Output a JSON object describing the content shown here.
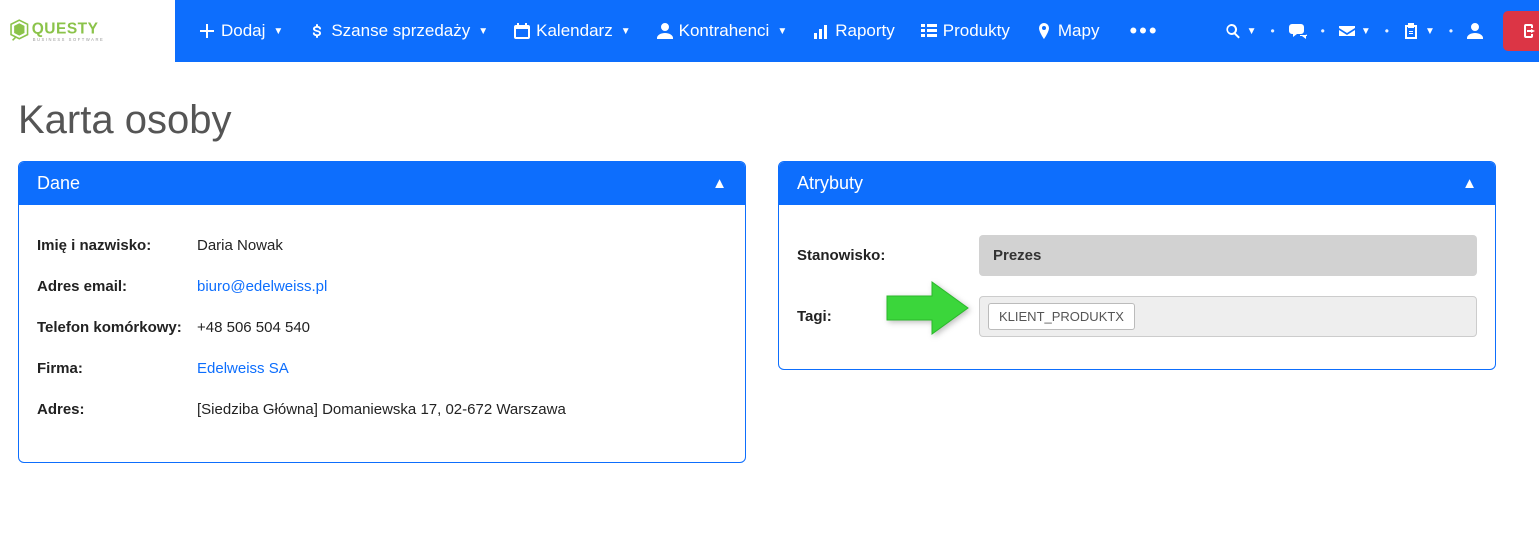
{
  "brand": {
    "name": "QUESTY",
    "subtitle": "BUSINESS SOFTWARE"
  },
  "nav": {
    "dodaj": "Dodaj",
    "szanse": "Szanse sprzedaży",
    "kalendarz": "Kalendarz",
    "kontrahenci": "Kontrahenci",
    "raporty": "Raporty",
    "produkty": "Produkty",
    "mapy": "Mapy"
  },
  "page_title": "Karta osoby",
  "dane": {
    "header": "Dane",
    "labels": {
      "imie": "Imię i nazwisko:",
      "email": "Adres email:",
      "telefon": "Telefon komórkowy:",
      "firma": "Firma:",
      "adres": "Adres:"
    },
    "values": {
      "imie": "Daria Nowak",
      "email": "biuro@edelweiss.pl",
      "telefon": "+48 506 504 540",
      "firma": "Edelweiss SA",
      "adres": "[Siedziba Główna] Domaniewska 17, 02-672 Warszawa"
    }
  },
  "atrybuty": {
    "header": "Atrybuty",
    "labels": {
      "stanowisko": "Stanowisko:",
      "tagi": "Tagi:"
    },
    "values": {
      "stanowisko": "Prezes",
      "tag": "KLIENT_PRODUKTX"
    }
  }
}
